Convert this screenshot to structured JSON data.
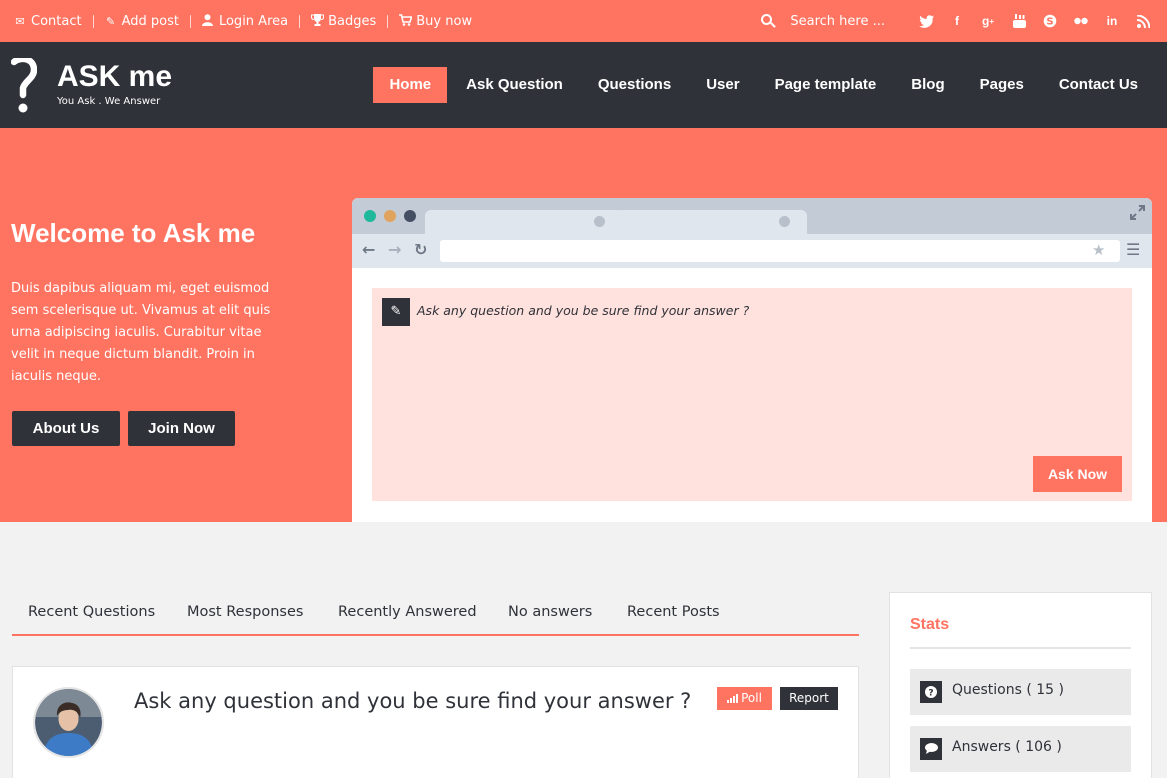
{
  "topbar": {
    "links": [
      {
        "icon": "envelope-icon",
        "label": "Contact"
      },
      {
        "icon": "pencil-icon",
        "label": "Add post"
      },
      {
        "icon": "user-icon",
        "label": "Login Area"
      },
      {
        "icon": "trophy-icon",
        "label": "Badges"
      },
      {
        "icon": "cart-icon",
        "label": "Buy now"
      }
    ],
    "search_placeholder": "Search here ...",
    "social_icons": [
      "twitter-icon",
      "facebook-icon",
      "google-plus-icon",
      "youtube-icon",
      "skype-icon",
      "flickr-icon",
      "linkedin-icon",
      "rss-icon"
    ]
  },
  "header": {
    "logo_title": "ASK me",
    "logo_tagline": "You Ask . We Answer",
    "nav": [
      "Home",
      "Ask Question",
      "Questions",
      "User",
      "Page template",
      "Blog",
      "Pages",
      "Contact Us"
    ],
    "active_nav": "Home"
  },
  "hero": {
    "title": "Welcome to Ask me",
    "text": "Duis dapibus aliquam mi, eget euismod sem scelerisque ut. Vivamus at elit quis urna adipiscing iaculis. Curabitur vitae velit in neque dictum blandit. Proin in iaculis neque.",
    "about_button": "About Us",
    "join_button": "Join Now",
    "ask_placeholder": "Ask any question and you be sure find your answer ?",
    "ask_button": "Ask Now"
  },
  "tabs": [
    "Recent Questions",
    "Most Responses",
    "Recently Answered",
    "No answers",
    "Recent Posts"
  ],
  "question": {
    "title": "Ask any question and you be sure find your answer ?",
    "poll_label": "Poll",
    "report_label": "Report"
  },
  "stats": {
    "title": "Stats",
    "items": [
      {
        "icon": "question-icon",
        "label": "Questions ( 15 )"
      },
      {
        "icon": "comment-icon",
        "label": "Answers ( 106 )"
      }
    ]
  },
  "colors": {
    "accent": "#ff7361",
    "dark": "#2f3239",
    "ask_box": "#ffe1dd"
  }
}
